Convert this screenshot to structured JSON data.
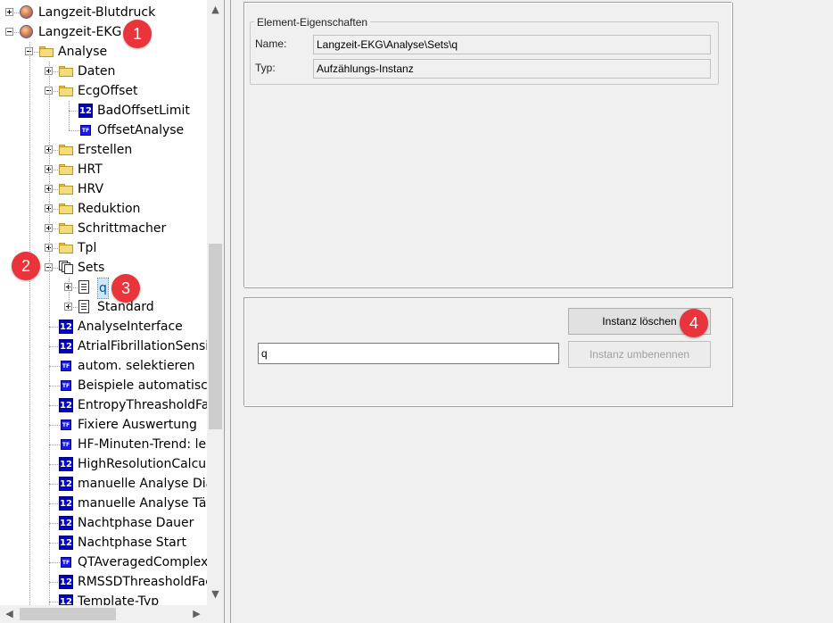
{
  "tree": {
    "rows": [
      {
        "label": "Langzeit-Blutdruck",
        "icon": "globe-icon",
        "expander": "plus",
        "level": 0
      },
      {
        "label": "Langzeit-EKG",
        "icon": "globe-icon",
        "expander": "minus",
        "level": 0
      },
      {
        "label": "Analyse",
        "icon": "folder-icon",
        "expander": "minus",
        "level": 1
      },
      {
        "label": "Daten",
        "icon": "folder-icon",
        "expander": "plus",
        "level": 2
      },
      {
        "label": "EcgOffset",
        "icon": "folder-icon",
        "expander": "minus",
        "level": 2
      },
      {
        "label": "BadOffsetLimit",
        "icon": "number-12-icon",
        "expander": "none",
        "level": 3
      },
      {
        "label": "OffsetAnalyse",
        "icon": "tf-icon",
        "expander": "none",
        "level": 3
      },
      {
        "label": "Erstellen",
        "icon": "folder-icon",
        "expander": "plus",
        "level": 2
      },
      {
        "label": "HRT",
        "icon": "folder-icon",
        "expander": "plus",
        "level": 2
      },
      {
        "label": "HRV",
        "icon": "folder-icon",
        "expander": "plus",
        "level": 2
      },
      {
        "label": "Reduktion",
        "icon": "folder-icon",
        "expander": "plus",
        "level": 2
      },
      {
        "label": "Schrittmacher",
        "icon": "folder-icon",
        "expander": "plus",
        "level": 2
      },
      {
        "label": "Tpl",
        "icon": "folder-icon",
        "expander": "plus",
        "level": 2
      },
      {
        "label": "Sets",
        "icon": "sets-icon",
        "expander": "minus",
        "level": 2
      },
      {
        "label": "q",
        "icon": "document-icon",
        "expander": "plus",
        "level": 3,
        "selected": true
      },
      {
        "label": "Standard",
        "icon": "document-icon",
        "expander": "plus",
        "level": 3
      },
      {
        "label": "AnalyseInterface",
        "icon": "number-12-icon",
        "expander": "none",
        "level": 2
      },
      {
        "label": "AtrialFibrillationSensi",
        "icon": "number-12-icon",
        "expander": "none",
        "level": 2
      },
      {
        "label": "autom. selektieren",
        "icon": "tf-icon",
        "expander": "none",
        "level": 2
      },
      {
        "label": "Beispiele automatisch",
        "icon": "tf-icon",
        "expander": "none",
        "level": 2
      },
      {
        "label": "EntropyThreasholdFac",
        "icon": "number-12-icon",
        "expander": "none",
        "level": 2
      },
      {
        "label": "Fixiere Auswertung",
        "icon": "tf-icon",
        "expander": "none",
        "level": 2
      },
      {
        "label": "HF-Minuten-Trend: le",
        "icon": "tf-icon",
        "expander": "none",
        "level": 2
      },
      {
        "label": "HighResolutionCalcul",
        "icon": "number-12-icon",
        "expander": "none",
        "level": 2
      },
      {
        "label": "manuelle Analyse Dia",
        "icon": "number-12-icon",
        "expander": "none",
        "level": 2
      },
      {
        "label": "manuelle Analyse Tät",
        "icon": "number-12-icon",
        "expander": "none",
        "level": 2
      },
      {
        "label": "Nachtphase Dauer",
        "icon": "number-12-icon",
        "expander": "none",
        "level": 2
      },
      {
        "label": "Nachtphase Start",
        "icon": "number-12-icon",
        "expander": "none",
        "level": 2
      },
      {
        "label": "QTAveragedComplex",
        "icon": "tf-icon",
        "expander": "none",
        "level": 2
      },
      {
        "label": "RMSSDThreasholdFac",
        "icon": "number-12-icon",
        "expander": "none",
        "level": 2
      },
      {
        "label": "Template-Typ",
        "icon": "number-12-icon",
        "expander": "none",
        "level": 2
      }
    ],
    "badge_12_text": "12",
    "badge_tf_text": "TF"
  },
  "properties": {
    "group_title": "Element-Eigenschaften",
    "name_label": "Name:",
    "name_value": "Langzeit-EKG\\Analyse\\Sets\\q",
    "type_label": "Typ:",
    "type_value": "Aufzählungs-Instanz"
  },
  "instance": {
    "delete_button": "Instanz löschen",
    "rename_button": "Instanz umbenennen",
    "name_input_value": "q"
  },
  "callouts": [
    "1",
    "2",
    "3",
    "4"
  ],
  "colors": {
    "callout": "#e8343a",
    "selection": "#cce8ff",
    "badge_blue": "#0000c8"
  }
}
